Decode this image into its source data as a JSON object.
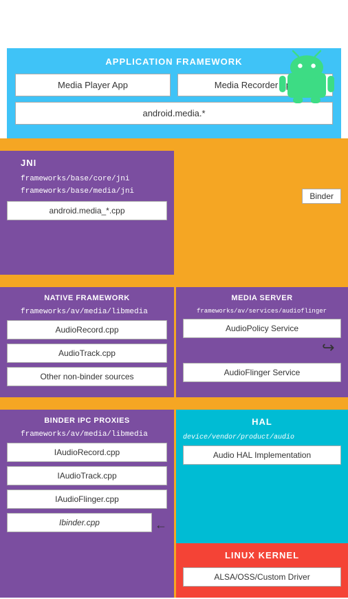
{
  "android_logo": {
    "alt": "Android Logo"
  },
  "app_framework": {
    "title": "APPLICATION FRAMEWORK",
    "media_player": "Media Player App",
    "media_recorder": "Media Recorder App",
    "android_media": "android.media.*"
  },
  "jni": {
    "title": "JNI",
    "path1": "frameworks/base/core/jni",
    "path2": "frameworks/base/media/jni",
    "cpp": "android.media_*.cpp"
  },
  "binder": {
    "label": "Binder"
  },
  "native_framework": {
    "title": "NATIVE FRAMEWORK",
    "path": "frameworks/av/media/libmedia",
    "items": [
      "AudioRecord.cpp",
      "AudioTrack.cpp",
      "Other non-binder sources"
    ]
  },
  "media_server": {
    "title": "MEDIA SERVER",
    "path": "frameworks/av/services/audioflinger",
    "items": [
      "AudioPolicy Service",
      "AudioFlinger Service"
    ]
  },
  "binder_ipc": {
    "title": "BINDER IPC PROXIES",
    "path": "frameworks/av/media/libmedia",
    "items": [
      "IAudioRecord.cpp",
      "IAudioTrack.cpp",
      "IAudioFlinger.cpp",
      "Ibinder.cpp"
    ]
  },
  "hal": {
    "title": "HAL",
    "path": "device/vendor/product/audio",
    "item": "Audio HAL Implementation"
  },
  "linux_kernel": {
    "title": "LINUX KERNEL",
    "item": "ALSA/OSS/Custom Driver"
  }
}
